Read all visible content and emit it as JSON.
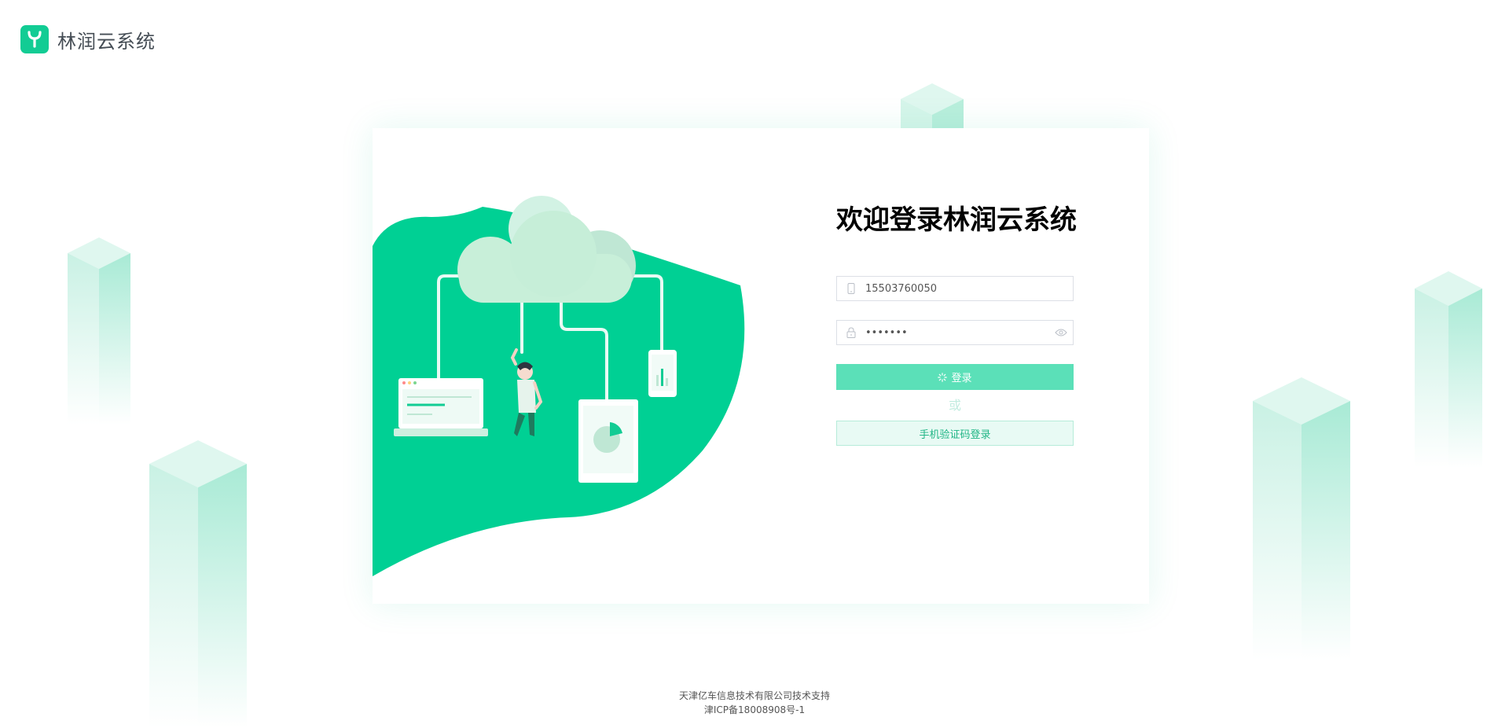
{
  "brand": {
    "name": "林润云系统",
    "color": "#12cc94"
  },
  "login": {
    "title": "欢迎登录林润云系统",
    "phone": {
      "value": "15503760050",
      "icon": "phone-icon"
    },
    "password": {
      "value": "•••••••",
      "prefix_icon": "lock-icon",
      "suffix_icon": "eye-icon"
    },
    "login_button": {
      "label": "登录",
      "icon": "loading-spinner-icon"
    },
    "or_text": "或",
    "sms_button": {
      "label": "手机验证码登录"
    }
  },
  "footer": {
    "support": "天津亿车信息技术有限公司技术支持",
    "icp": "津ICP备18008908号-1"
  },
  "colors": {
    "accent": "#12cc94",
    "blob": "#00d094",
    "button": "#5be0b8",
    "sms_bg": "#e8faf4"
  }
}
